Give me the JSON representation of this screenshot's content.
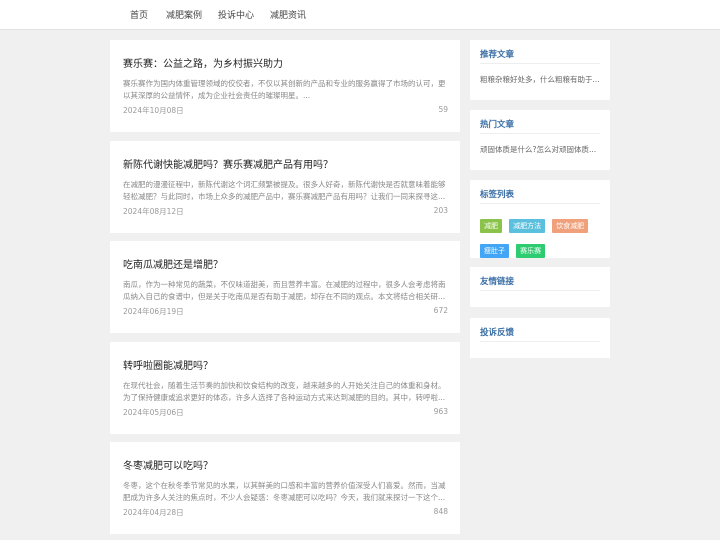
{
  "nav": {
    "items": [
      "首页",
      "减肥案例",
      "投诉中心",
      "减肥资讯"
    ]
  },
  "articles": [
    {
      "title": "赛乐赛：公益之路，为乡村振兴助力",
      "excerpt": "赛乐赛作为国内体重管理领域的佼佼者，不仅以其创新的产品和专业的服务赢得了市场的认可，更以其深厚的公益情怀，成为企业社会责任的璀璨明星。...",
      "date": "2024年10月08日",
      "views": "59"
    },
    {
      "title": "新陈代谢快能减肥吗？赛乐赛减肥产品有用吗？",
      "excerpt": "在减肥的漫漫征程中，新陈代谢这个词汇频繁被提及。很多人好奇，新陈代谢快是否就意味着能够轻松减肥？与此同时，市场上众多的减肥产品中，赛乐赛减肥产品有用吗？让我们一同来探寻这...",
      "date": "2024年08月12日",
      "views": "203"
    },
    {
      "title": "吃南瓜减肥还是增肥？",
      "excerpt": "南瓜，作为一种常见的蔬菜，不仅味道甜美，而且营养丰富。在减肥的过程中，很多人会考虑将南瓜纳入自己的食谱中，但是关于吃南瓜是否有助于减肥，却存在不同的观点。本文将结合相关研...",
      "date": "2024年06月19日",
      "views": "672"
    },
    {
      "title": "转呼啦圈能减肥吗？",
      "excerpt": "在现代社会，随着生活节奏的加快和饮食结构的改变，越来越多的人开始关注自己的体重和身材。为了保持健康或追求更好的体态，许多人选择了各种运动方式来达到减肥的目的。其中，转呼啦...",
      "date": "2024年05月06日",
      "views": "963"
    },
    {
      "title": "冬枣减肥可以吃吗？",
      "excerpt": "冬枣，这个在秋冬季节常见的水果，以其鲜美的口感和丰富的营养价值深受人们喜爱。然而，当减肥成为许多人关注的焦点时，不少人会疑惑：冬枣减肥可以吃吗？今天，我们就来探讨一下这个...",
      "date": "2024年04月28日",
      "views": "848"
    }
  ],
  "sidebar": {
    "recommended": {
      "title": "推荐文章",
      "item": "粗粮杂粮好处多，什么粗粮有助于..."
    },
    "hot": {
      "title": "热门文章",
      "item": "顽固体质是什么?怎么对顽固体质..."
    },
    "tags": {
      "title": "标签列表",
      "items": [
        {
          "label": "减肥",
          "color": "#8bc34a"
        },
        {
          "label": "减肥方法",
          "color": "#5bc0de"
        },
        {
          "label": "饮食减肥",
          "color": "#f0a07a"
        },
        {
          "label": "瘦肚子",
          "color": "#42a5f5"
        },
        {
          "label": "赛乐赛",
          "color": "#2ecc71"
        }
      ]
    },
    "links": {
      "title": "友情链接"
    },
    "complaints": {
      "title": "投诉反馈"
    }
  }
}
